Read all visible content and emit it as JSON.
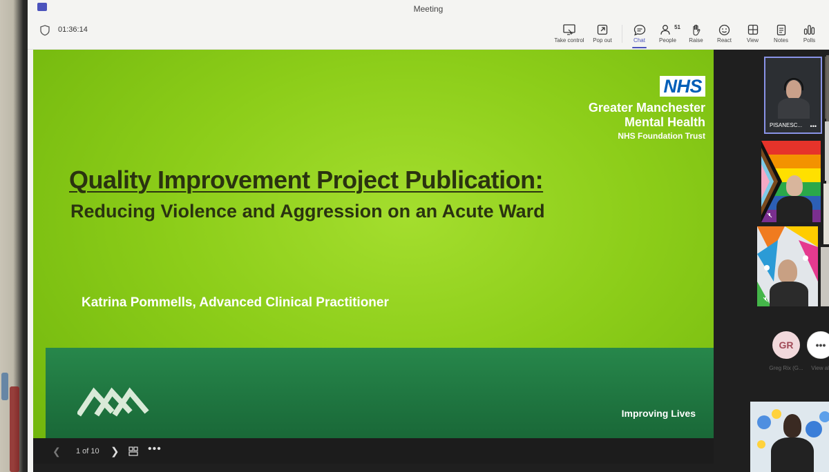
{
  "window": {
    "title": "Meeting"
  },
  "toolbar": {
    "timer": "01:36:14",
    "take_control": "Take control",
    "pop_out": "Pop out",
    "chat": "Chat",
    "people": "People",
    "people_count": "51",
    "raise": "Raise",
    "react": "React",
    "view": "View",
    "notes": "Notes",
    "polls": "Polls"
  },
  "slide": {
    "nhs_logo": "NHS",
    "org_line1": "Greater Manchester",
    "org_line2": "Mental Health",
    "org_line3": "NHS Foundation Trust",
    "title": "Quality Improvement Project Publication:",
    "subtitle": "Reducing Violence and Aggression on an Acute Ward",
    "author": "Katrina Pommells, Advanced Clinical Practitioner",
    "slogan": "Improving Lives",
    "colors": {
      "green": "#8ccd19",
      "dark_green": "#1c6f3c",
      "nhs_blue": "#005eb8"
    }
  },
  "slide_controls": {
    "page": "1 of 10"
  },
  "participants": {
    "active_speaker_name": "PISANESC...",
    "avatar_initials": "GR",
    "avatar_name": "Greg Rix (G...",
    "view_all": "View all"
  }
}
